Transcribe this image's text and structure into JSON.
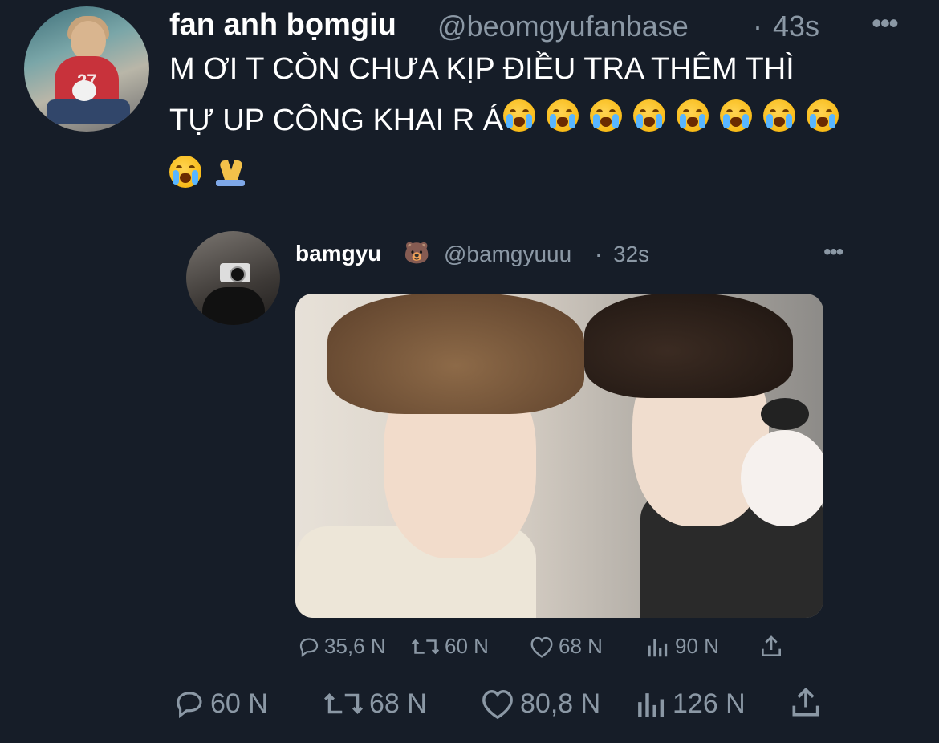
{
  "main_tweet": {
    "display_name": "fan anh bọmgiu",
    "handle": "@beomgyufanbase",
    "separator": "·",
    "time": "43s",
    "more": "•••",
    "text_line1": "M ƠI T CÒN CHƯA KỊP ĐIỀU TRA THÊM THÌ",
    "text_line2": "TỰ UP CÔNG KHAI R Á",
    "actions": {
      "replies": "60 N",
      "retweets": "68 N",
      "likes": "80,8 N",
      "views": "126 N"
    }
  },
  "quoted_tweet": {
    "display_name": "bamgyu",
    "name_emoji": "🐻",
    "handle": "@bamgyuuu",
    "separator": "·",
    "time": "32s",
    "more": "•••",
    "actions": {
      "replies": "35,6 N",
      "retweets": "60 N",
      "likes": "68 N",
      "views": "90 N"
    }
  },
  "icons": [
    "reply-icon",
    "retweet-icon",
    "like-icon",
    "views-icon",
    "share-icon",
    "crying-face-emoji",
    "folded-hands-emoji",
    "bear-emoji"
  ],
  "colors": {
    "background": "#161d28",
    "text": "#ffffff",
    "muted": "#8b98a5"
  }
}
